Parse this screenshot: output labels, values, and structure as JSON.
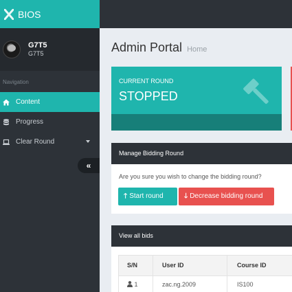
{
  "app": {
    "brand": "BIOS"
  },
  "profile": {
    "name": "G7T5",
    "sub": "G7T5"
  },
  "sidebar": {
    "header": "Navigation",
    "items": [
      {
        "label": "Content",
        "icon": "home-icon",
        "active": true
      },
      {
        "label": "Progress",
        "icon": "database-icon",
        "active": false
      },
      {
        "label": "Clear Round",
        "icon": "laptop-icon",
        "active": false,
        "has_caret": true
      }
    ],
    "collapse_glyph": "«"
  },
  "page": {
    "title": "Admin Portal",
    "subtitle": "Home"
  },
  "stat": {
    "label": "CURRENT ROUND",
    "value": "STOPPED",
    "icon": "gavel-icon"
  },
  "manage_panel": {
    "title": "Manage Bidding Round",
    "question": "Are you sure you wish to change the bidding round?",
    "start_label": "Start round",
    "decrease_label": "Decrease bidding round"
  },
  "bids_panel": {
    "title": "View all bids",
    "columns": [
      "S/N",
      "User ID",
      "Course ID"
    ],
    "rows": [
      {
        "sn": "1",
        "user_id": "zac.ng.2009",
        "course_id": "IS100"
      }
    ]
  },
  "colors": {
    "accent": "#1fb5ad",
    "accent_dark": "#177f79",
    "danger": "#e8514f",
    "sidebar": "#2d3238",
    "background": "#e9edf2"
  }
}
